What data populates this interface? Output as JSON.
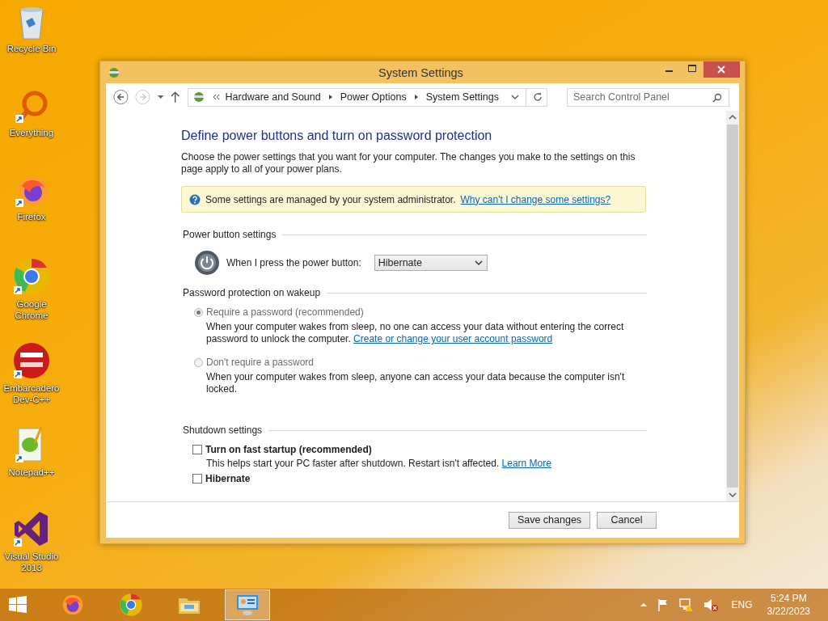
{
  "desktop_icons": [
    {
      "kind": "recycle",
      "label": "Recycle Bin"
    },
    {
      "kind": "everything",
      "label": "Everything"
    },
    {
      "kind": "firefox",
      "label": "Firefox"
    },
    {
      "kind": "chrome",
      "label": "Google Chrome"
    },
    {
      "kind": "devcpp",
      "label": "Embarcadero Dev-C++"
    },
    {
      "kind": "notepad",
      "label": "Notepad++"
    },
    {
      "kind": "vstudio",
      "label": "Visual Studio 2013"
    }
  ],
  "window": {
    "title": "System Settings",
    "breadcrumb": [
      "Hardware and Sound",
      "Power Options",
      "System Settings"
    ],
    "search": {
      "placeholder": "Search Control Panel"
    },
    "heading": "Define power buttons and turn on password protection",
    "description": "Choose the power settings that you want for your computer. The changes you make to the settings on this page apply to all of your power plans.",
    "notice": {
      "text": "Some settings are managed by your system administrator.",
      "link": "Why can't I change some settings?"
    },
    "power_section": {
      "title": "Power button settings",
      "label": "When I press the power button:",
      "value": "Hibernate"
    },
    "password_section": {
      "title": "Password protection on wakeup",
      "options": [
        {
          "label": "Require a password (recommended)",
          "description": "When your computer wakes from sleep, no one can access your data without entering the correct password to unlock the computer.",
          "link": "Create or change your user account password",
          "selected": true,
          "disabled": true
        },
        {
          "label": "Don't require a password",
          "description": "When your computer wakes from sleep, anyone can access your data because the computer isn't locked.",
          "selected": false,
          "disabled": true
        }
      ]
    },
    "shutdown_section": {
      "title": "Shutdown settings",
      "options": [
        {
          "label": "Turn on fast startup (recommended)",
          "description": "This helps start your PC faster after shutdown. Restart isn't affected.",
          "link": "Learn More",
          "checked": false
        },
        {
          "label": "Hibernate",
          "checked": false
        }
      ]
    },
    "buttons": [
      "Save changes",
      "Cancel"
    ]
  },
  "taskbar": {
    "apps": [
      {
        "kind": "firefox",
        "selected": false
      },
      {
        "kind": "chrome",
        "selected": false
      },
      {
        "kind": "explorer",
        "selected": false
      },
      {
        "kind": "control",
        "selected": true
      }
    ],
    "language": "ENG",
    "time": "5:24 PM",
    "date": "3/22/2023"
  }
}
